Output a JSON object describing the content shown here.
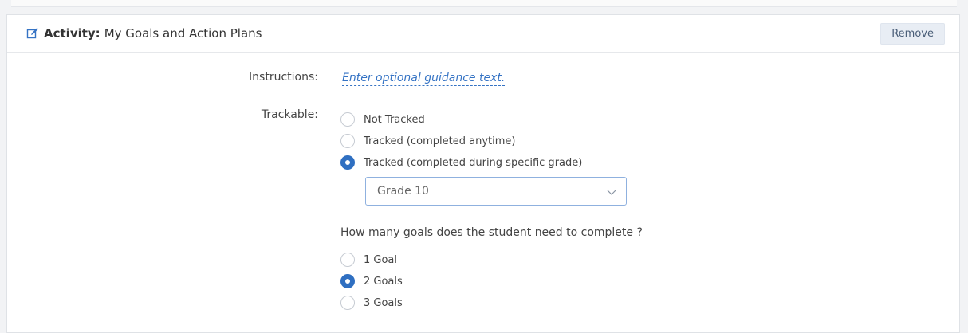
{
  "header": {
    "edit_icon": "edit-icon",
    "label": "Activity:",
    "title": "My Goals and Action Plans",
    "remove_label": "Remove"
  },
  "instructions": {
    "label": "Instructions:",
    "placeholder_link": "Enter optional guidance text."
  },
  "trackable": {
    "label": "Trackable:",
    "options": [
      {
        "label": "Not Tracked",
        "checked": false
      },
      {
        "label": "Tracked (completed anytime)",
        "checked": false
      },
      {
        "label": "Tracked (completed during specific grade)",
        "checked": true
      }
    ],
    "grade_select": {
      "value": "Grade 10",
      "icon": "chevron-down-icon"
    }
  },
  "goals": {
    "question": "How many goals does the student need to complete ?",
    "options": [
      {
        "label": "1 Goal",
        "checked": false
      },
      {
        "label": "2 Goals",
        "checked": true
      },
      {
        "label": "3 Goals",
        "checked": false
      }
    ]
  },
  "colors": {
    "accent": "#2f6fc1",
    "link": "#3573c4",
    "remove_bg": "#e8edf4"
  }
}
